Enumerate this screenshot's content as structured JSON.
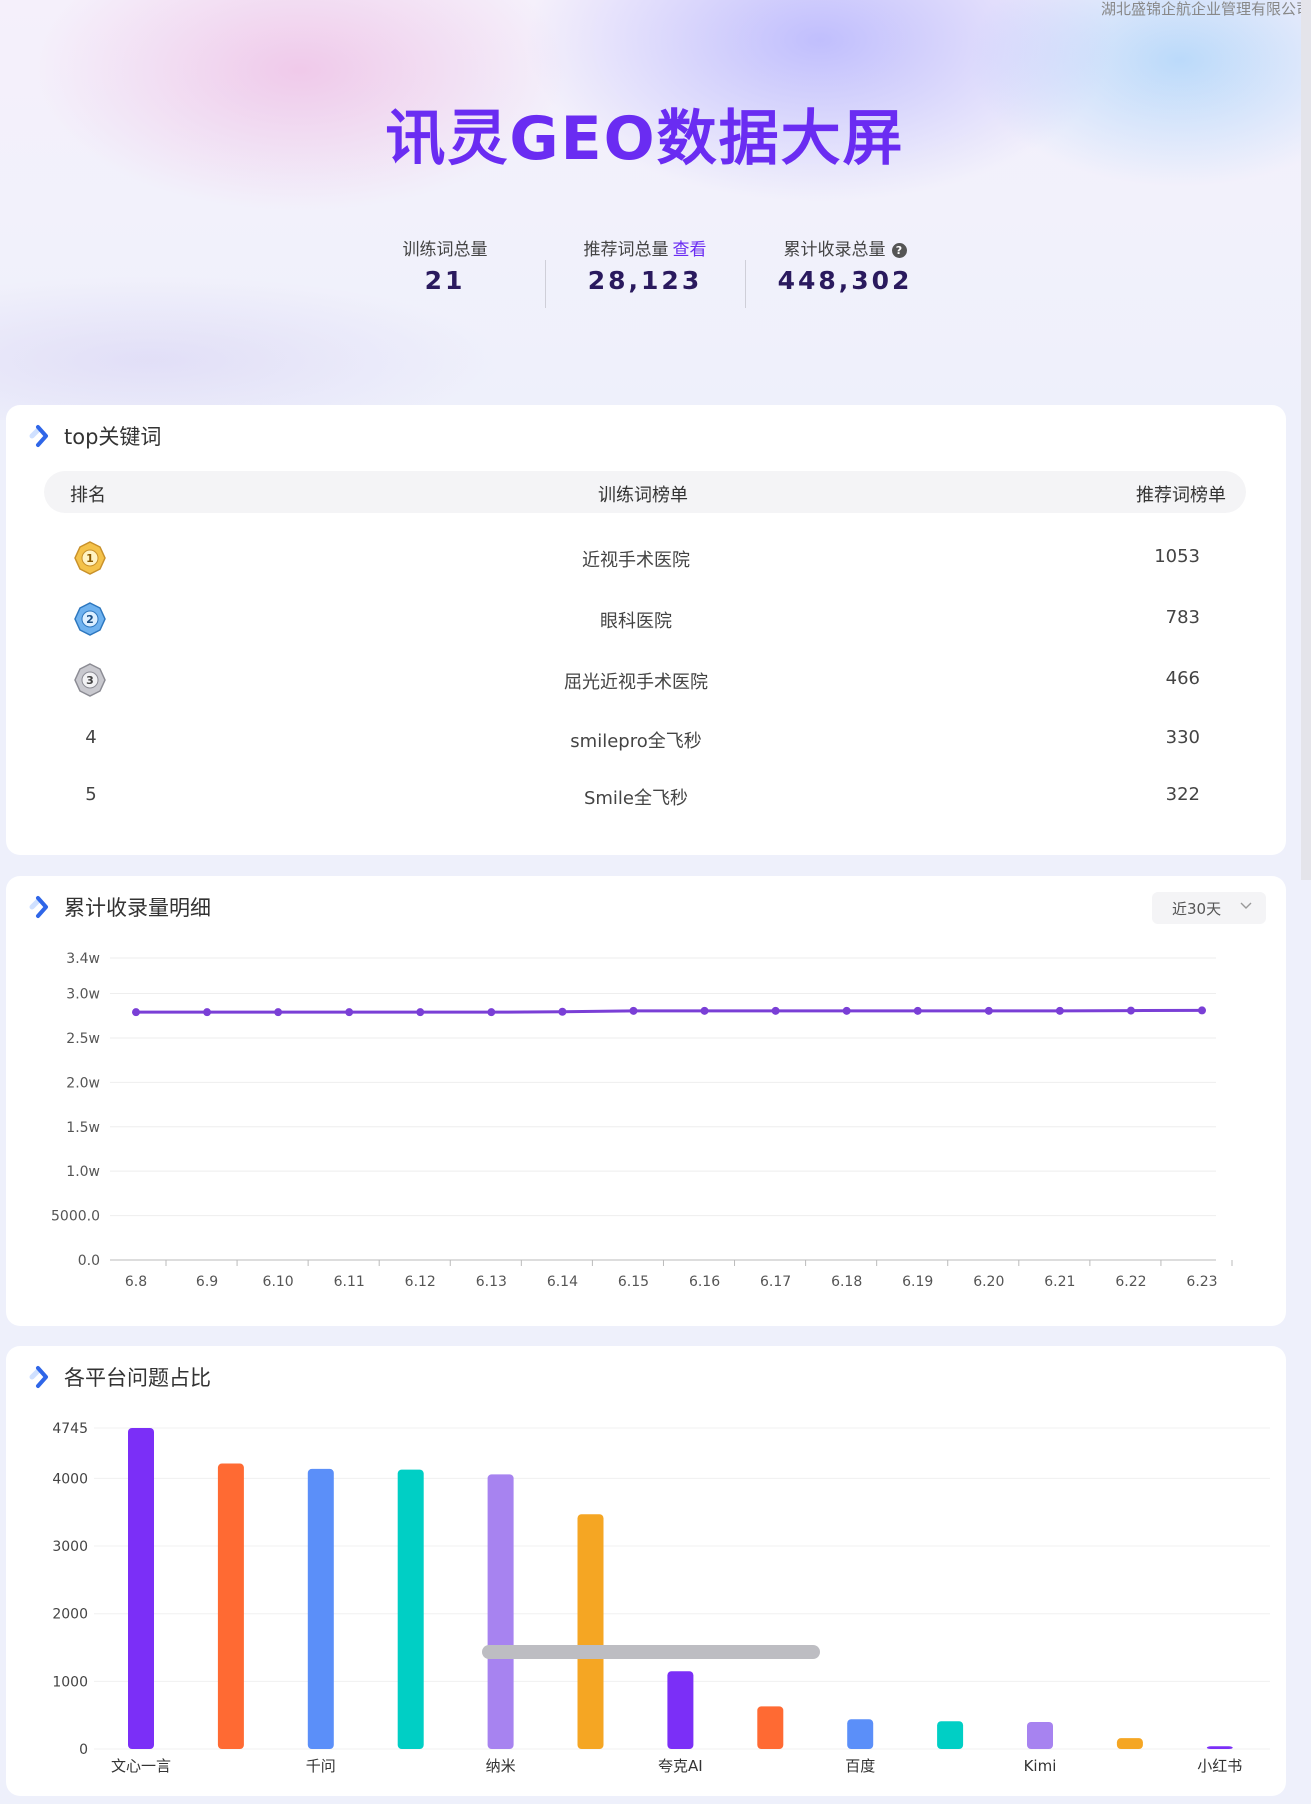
{
  "header": {
    "company": "湖北盛锦企航企业管理有限公司",
    "title": "讯灵GEO数据大屏"
  },
  "stats": [
    {
      "label": "训练词总量",
      "value": "21"
    },
    {
      "label": "推荐词总量",
      "link": "查看",
      "value": "28,123"
    },
    {
      "label": "累计收录总量",
      "help": "?",
      "value": "448,302"
    }
  ],
  "keywords": {
    "title": "top关键词",
    "columns": [
      "排名",
      "训练词榜单",
      "推荐词榜单"
    ],
    "rows": [
      {
        "rank": "1",
        "keyword": "近视手术医院",
        "count": "1053",
        "medal": "gold"
      },
      {
        "rank": "2",
        "keyword": "眼科医院",
        "count": "783",
        "medal": "blue"
      },
      {
        "rank": "3",
        "keyword": "屈光近视手术医院",
        "count": "466",
        "medal": "silver"
      },
      {
        "rank": "4",
        "keyword": "smilepro全飞秒",
        "count": "330"
      },
      {
        "rank": "5",
        "keyword": "Smile全飞秒",
        "count": "322"
      }
    ]
  },
  "trend": {
    "title": "累计收录量明细",
    "range_label": "近30天"
  },
  "platforms": {
    "title": "各平台问题占比"
  },
  "colors": {
    "accent": "#6a2cf2",
    "line": "#7a3fd6",
    "bars": [
      "#7b2ff7",
      "#ff6a33",
      "#5b8ff9",
      "#00cfc5",
      "#a783f0",
      "#f5a623"
    ]
  },
  "chart_data": [
    {
      "type": "line",
      "x": [
        "6.8",
        "6.9",
        "6.10",
        "6.11",
        "6.12",
        "6.13",
        "6.14",
        "6.15",
        "6.16",
        "6.17",
        "6.18",
        "6.19",
        "6.20",
        "6.21",
        "6.22",
        "6.23"
      ],
      "series": [
        {
          "values": [
            27900,
            27900,
            27900,
            27900,
            27900,
            27900,
            27950,
            28050,
            28050,
            28050,
            28050,
            28050,
            28050,
            28050,
            28080,
            28100
          ]
        }
      ],
      "yticks": [
        "0.0",
        "5000.0",
        "1.0w",
        "1.5w",
        "2.0w",
        "2.5w",
        "3.0w",
        "3.4w"
      ],
      "ytick_values": [
        0,
        5000,
        10000,
        15000,
        20000,
        25000,
        30000,
        34000
      ],
      "ylim": [
        0,
        34000
      ],
      "grid": true
    },
    {
      "type": "bar",
      "categories": [
        "文心一言",
        "",
        "千问",
        "",
        "纳米",
        "",
        "夸克AI",
        "",
        "百度",
        "",
        "Kimi",
        "",
        "小红书"
      ],
      "values": [
        4745,
        4220,
        4140,
        4130,
        4060,
        3470,
        1150,
        630,
        440,
        410,
        400,
        160,
        40
      ],
      "yticks": [
        "0",
        "1000",
        "2000",
        "3000",
        "4000",
        "4745"
      ],
      "ytick_values": [
        0,
        1000,
        2000,
        3000,
        4000,
        4745
      ],
      "ylim": [
        0,
        4745
      ],
      "grid": true
    }
  ]
}
